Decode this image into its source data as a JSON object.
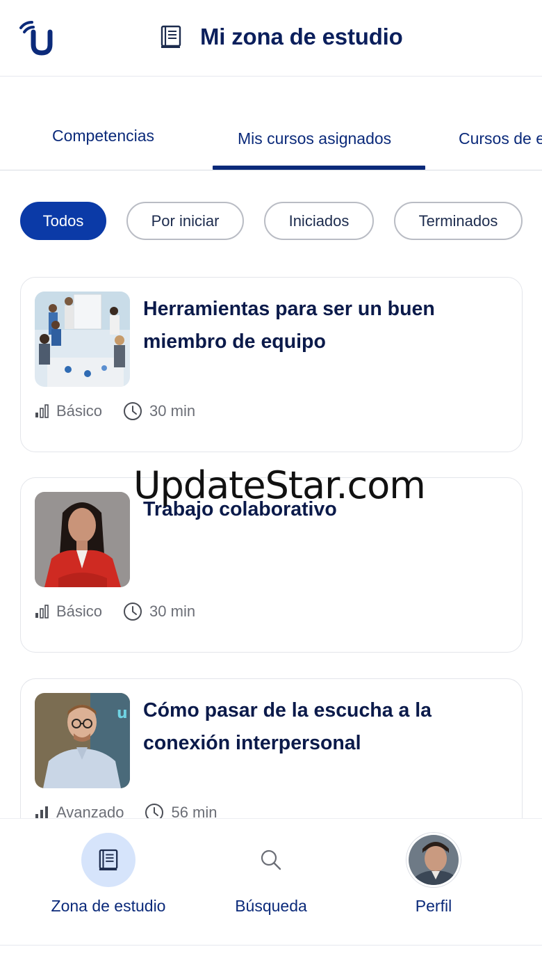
{
  "header": {
    "title": "Mi zona de estudio",
    "logo_icon": "brand-logo-icon",
    "title_icon": "book-icon"
  },
  "tabs": [
    {
      "label": "Competencias",
      "active": false
    },
    {
      "label": "Mis cursos asignados",
      "active": true
    },
    {
      "label": "Cursos de e",
      "active": false
    }
  ],
  "filters": [
    {
      "label": "Todos",
      "active": true
    },
    {
      "label": "Por iniciar",
      "active": false
    },
    {
      "label": "Iniciados",
      "active": false
    },
    {
      "label": "Terminados",
      "active": false
    }
  ],
  "courses": [
    {
      "title": "Herramientas para ser un buen miembro de equipo",
      "level": "Básico",
      "duration": "30 min",
      "thumbnail": "team-meeting-photo"
    },
    {
      "title": "Trabajo colaborativo",
      "level": "Básico",
      "duration": "30 min",
      "thumbnail": "woman-red-blazer-photo"
    },
    {
      "title": "Cómo pasar de la escucha a la conexión interpersonal",
      "level": "Avanzado",
      "duration": "56 min",
      "thumbnail": "man-glasses-photo"
    }
  ],
  "watermark": "UpdateStar.com",
  "bottom_nav": [
    {
      "label": "Zona de estudio",
      "icon": "book-icon",
      "active": true
    },
    {
      "label": "Búsqueda",
      "icon": "search-icon",
      "active": false
    },
    {
      "label": "Perfil",
      "icon": "avatar",
      "active": false
    }
  ],
  "colors": {
    "primary": "#0b2a7a",
    "accent": "#0b3aa7",
    "active_nav_bg": "#d6e4fb",
    "muted_text": "#6b6e76"
  }
}
